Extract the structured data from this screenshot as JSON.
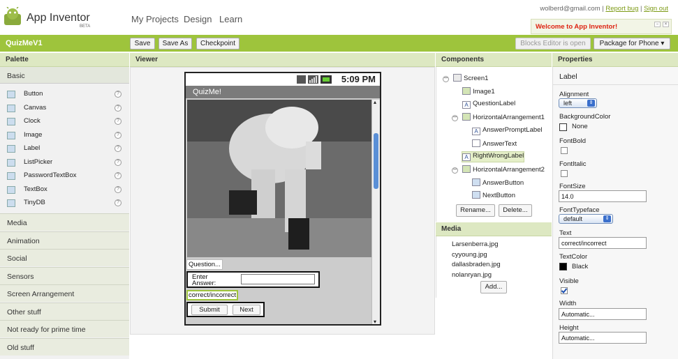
{
  "app": {
    "name": "App Inventor",
    "beta": "BETA"
  },
  "nav": {
    "my_projects": "My Projects",
    "design": "Design",
    "learn": "Learn"
  },
  "user": {
    "email": "wolberd@gmail.com",
    "sep1": "|",
    "report_bug": "Report bug",
    "sep2": "|",
    "sign_out": "Sign out"
  },
  "welcome": "Welcome to App Inventor!",
  "toolbar": {
    "project": "QuizMeV1",
    "save": "Save",
    "save_as": "Save As",
    "checkpoint": "Checkpoint",
    "blocks_editor": "Blocks Editor is open",
    "package": "Package for Phone",
    "package_arrow": "▾"
  },
  "palette": {
    "title": "Palette",
    "basic": "Basic",
    "items": [
      {
        "label": "Button",
        "icon": "button-icon"
      },
      {
        "label": "Canvas",
        "icon": "canvas-icon"
      },
      {
        "label": "Clock",
        "icon": "clock-icon"
      },
      {
        "label": "Image",
        "icon": "image-icon"
      },
      {
        "label": "Label",
        "icon": "label-icon"
      },
      {
        "label": "ListPicker",
        "icon": "listpicker-icon"
      },
      {
        "label": "PasswordTextBox",
        "icon": "password-icon"
      },
      {
        "label": "TextBox",
        "icon": "textbox-icon"
      },
      {
        "label": "TinyDB",
        "icon": "database-icon"
      }
    ],
    "help": "?",
    "sections": [
      "Media",
      "Animation",
      "Social",
      "Sensors",
      "Screen Arrangement",
      "Other stuff",
      "Not ready for prime time",
      "Old stuff"
    ]
  },
  "viewer": {
    "title": "Viewer",
    "phone_time": "5:09 PM",
    "screen_title": "QuizMe!",
    "question": "Question...",
    "answer_prompt": "Enter Answer:",
    "result": "correct/incorrect",
    "submit": "Submit",
    "next": "Next",
    "scroll_up": "▴",
    "scroll_down": "▾"
  },
  "components": {
    "title": "Components",
    "tree": [
      {
        "label": "Screen1",
        "icon": "screen-icon",
        "toggle": "−"
      },
      {
        "label": "Image1",
        "icon": "image-icon"
      },
      {
        "label": "QuestionLabel",
        "icon": "label-icon"
      },
      {
        "label": "HorizontalArrangement1",
        "icon": "arrangement-icon",
        "toggle": "−"
      },
      {
        "label": "AnswerPromptLabel",
        "icon": "label-icon"
      },
      {
        "label": "AnswerText",
        "icon": "textbox-icon"
      },
      {
        "label": "RightWrongLabel",
        "icon": "label-icon",
        "selected": true
      },
      {
        "label": "HorizontalArrangement2",
        "icon": "arrangement-icon",
        "toggle": "−"
      },
      {
        "label": "AnswerButton",
        "icon": "button-icon"
      },
      {
        "label": "NextButton",
        "icon": "button-icon"
      }
    ],
    "rename": "Rename...",
    "delete": "Delete..."
  },
  "media": {
    "title": "Media",
    "files": [
      "Larsenberra.jpg",
      "cyyoung.jpg",
      "dallasbraden.jpg",
      "nolanryan.jpg"
    ],
    "add": "Add..."
  },
  "properties": {
    "title": "Properties",
    "component": "Label",
    "alignment_label": "Alignment",
    "alignment": "left",
    "bgcolor_label": "BackgroundColor",
    "bgcolor": "None",
    "fontbold_label": "FontBold",
    "fontitalic_label": "FontItalic",
    "fontsize_label": "FontSize",
    "fontsize": "14.0",
    "typeface_label": "FontTypeface",
    "typeface": "default",
    "text_label": "Text",
    "text": "correct/incorrect",
    "textcolor_label": "TextColor",
    "textcolor": "Black",
    "visible_label": "Visible",
    "width_label": "Width",
    "width": "Automatic...",
    "height_label": "Height",
    "height": "Automatic..."
  },
  "colors": {
    "accent": "#9ec43c",
    "welcome_text": "#dd2211",
    "selection": "#e5efc8"
  }
}
